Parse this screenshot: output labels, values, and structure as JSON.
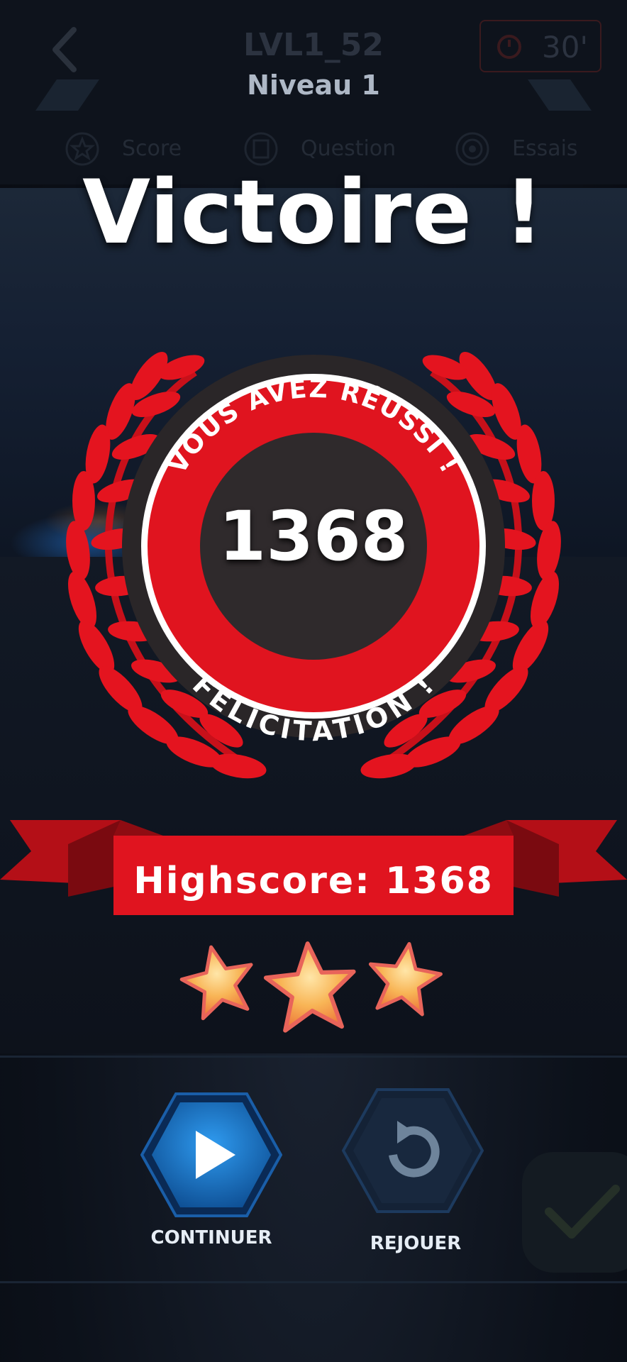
{
  "header": {
    "level_code": "LVL1_52",
    "level_name": "Niveau 1",
    "timer": "30'",
    "stats": [
      {
        "label": "Score",
        "icon": "star-icon"
      },
      {
        "label": "Question",
        "icon": "list-icon"
      },
      {
        "label": "Essais",
        "icon": "target-icon"
      }
    ]
  },
  "result": {
    "title": "Victoire !",
    "medal_top_text": "VOUS AVEZ RÉUSSI !",
    "medal_bottom_text": "FELICITATION !",
    "score": "1368",
    "highscore": "Highscore: 1368",
    "stars_earned": 3,
    "stars_total": 3
  },
  "actions": {
    "continue_label": "CONTINUER",
    "replay_label": "REJOUER"
  },
  "colors": {
    "accent_red": "#e0141f",
    "button_blue": "#1677c9",
    "star_orange": "#f6a647"
  }
}
